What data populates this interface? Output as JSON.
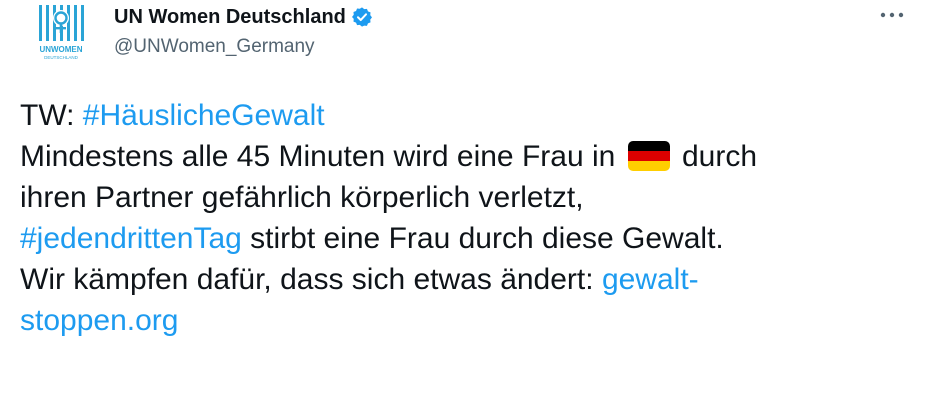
{
  "account": {
    "display_name": "UN Women Deutschland",
    "handle": "@UNWomen_Germany",
    "verified": true,
    "avatar_logo_text": "UNWOMEN DEUTSCHLAND"
  },
  "menu": {
    "icon": "more-dots-icon"
  },
  "tweet": {
    "line1_prefix": "TW: ",
    "hashtag1": "#HäuslicheGewalt",
    "line2_before_flag": "Mindestens alle 45 Minuten wird eine Frau in ",
    "flag": "germany-flag-emoji",
    "line2_after_flag": " durch",
    "line3": "ihren Partner gefährlich körperlich verletzt,",
    "hashtag2": "#jedendrittenTag",
    "line4_rest": " stirbt eine Frau durch diese Gewalt.",
    "line5_text": "Wir kämpfen dafür, dass sich etwas ändert: ",
    "link_part1": "gewalt-",
    "link_part2": "stoppen.org"
  },
  "colors": {
    "link": "#1d9bf0",
    "text": "#0f1419",
    "secondary": "#536471",
    "logo": "#2aa4d6",
    "verified": "#1d9bf0"
  }
}
